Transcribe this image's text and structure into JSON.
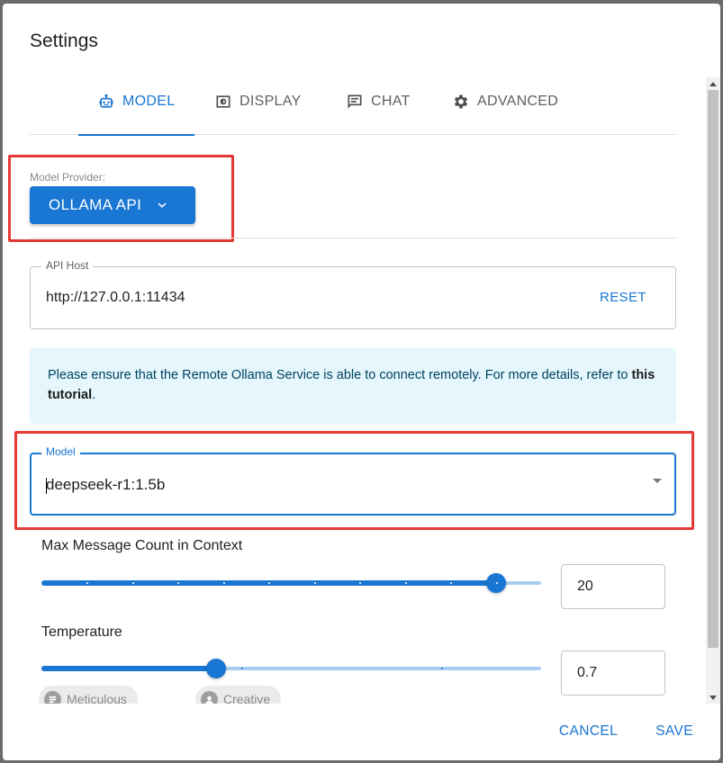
{
  "dialog": {
    "title": "Settings"
  },
  "tabs": [
    {
      "label": "MODEL",
      "icon": "robot-icon",
      "active": true
    },
    {
      "label": "DISPLAY",
      "icon": "display-icon",
      "active": false
    },
    {
      "label": "CHAT",
      "icon": "chat-icon",
      "active": false
    },
    {
      "label": "ADVANCED",
      "icon": "gear-icon",
      "active": false
    }
  ],
  "provider": {
    "label": "Model Provider:",
    "value": "OLLAMA API"
  },
  "api_host": {
    "label": "API Host",
    "value": "http://127.0.0.1:11434",
    "reset_label": "RESET"
  },
  "info": {
    "text": "Please ensure that the Remote Ollama Service is able to connect remotely. For more details, refer to ",
    "link": "this tutorial",
    "suffix": "."
  },
  "model": {
    "label": "Model",
    "value": "deepseek-r1:1.5b"
  },
  "max_messages": {
    "label": "Max Message Count in Context",
    "value": "20",
    "level": 0.91
  },
  "temperature": {
    "label": "Temperature",
    "value": "0.7",
    "level": 0.35,
    "chips": [
      "Meticulous",
      "Creative"
    ]
  },
  "actions": {
    "cancel": "CANCEL",
    "save": "SAVE"
  },
  "colors": {
    "accent": "#1976d2",
    "highlight": "#e53935",
    "info_bg": "#e5f6fd"
  }
}
